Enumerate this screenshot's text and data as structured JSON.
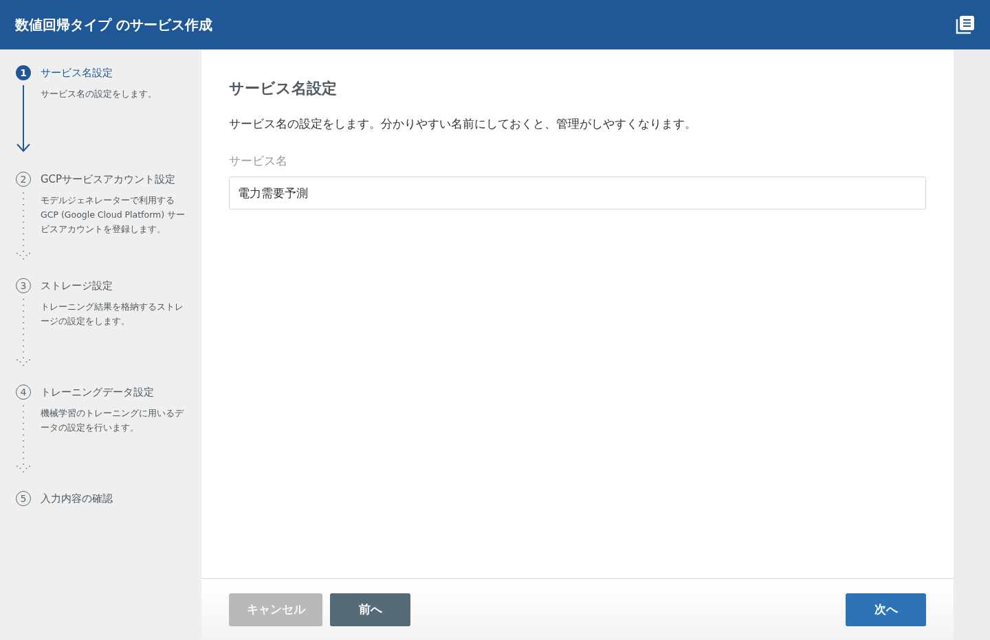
{
  "header": {
    "title": "数値回帰タイプ のサービス作成"
  },
  "steps": [
    {
      "number": "1",
      "title": "サービス名設定",
      "description": "サービス名の設定をします。",
      "selected": true
    },
    {
      "number": "2",
      "title": "GCPサービスアカウント設定",
      "description": "モデルジェネレーターで利用する GCP (Google Cloud Platform) サービスアカウントを登録します。",
      "selected": false
    },
    {
      "number": "3",
      "title": "ストレージ設定",
      "description": "トレーニング結果を格納するストレージの設定をします。",
      "selected": false
    },
    {
      "number": "4",
      "title": "トレーニングデータ設定",
      "description": "機械学習のトレーニングに用いるデータの設定を行います。",
      "selected": false
    },
    {
      "number": "5",
      "title": "入力内容の確認",
      "selected": false
    }
  ],
  "content": {
    "heading": "サービス名設定",
    "description": "サービス名の設定をします。分かりやすい名前にしておくと、管理がしやすくなります。",
    "field": {
      "label": "サービス名",
      "value": "電力需要予測"
    }
  },
  "buttons": [
    {
      "label": "キャンセル",
      "kind": "cancel",
      "disabled": true
    },
    {
      "label": "前へ",
      "kind": "back",
      "disabled": false
    },
    {
      "label": "次へ",
      "kind": "next",
      "disabled": false
    }
  ]
}
